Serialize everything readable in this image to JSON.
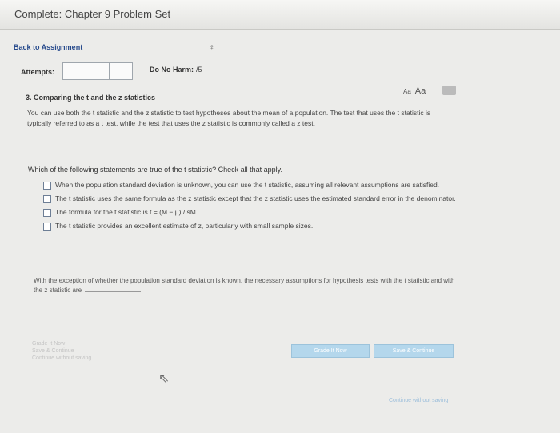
{
  "window": {
    "title": "Complete: Chapter 9 Problem Set",
    "title_extra": "."
  },
  "nav": {
    "back_link": "Back to Assignment",
    "top_icon": "♀"
  },
  "attempts": {
    "label": "Attempts:",
    "boxes": [
      "",
      "",
      ""
    ]
  },
  "do_no_harm": {
    "label": "Do No Harm:",
    "value": "/5"
  },
  "question": {
    "title": "3. Comparing the t and the z statistics",
    "font_controls": {
      "small": "Aa",
      "large": "Aa"
    },
    "intro": "You can use both the t statistic and the z statistic to test hypotheses about the mean of a population. The test that uses the t statistic is typically referred to as a t test, while the test that uses the z statistic is commonly called a z test.",
    "prompt": "Which of the following statements are true of the t statistic? Check all that apply.",
    "options": [
      {
        "text": "When the population standard deviation is unknown, you can use the t statistic, assuming all relevant assumptions are satisfied.",
        "checked": false
      },
      {
        "text": "The t statistic uses the same formula as the z statistic except that the z statistic uses the estimated standard error in the denominator.",
        "checked": false
      },
      {
        "text": "The formula for the t statistic is t = (M − μ) / sM.",
        "checked": false
      },
      {
        "text": "The t statistic provides an excellent estimate of z, particularly with small sample sizes.",
        "checked": false
      }
    ],
    "followup": "With the exception of whether the population standard deviation is known, the necessary assumptions for hypothesis tests with the t statistic and with the z statistic are"
  },
  "footer": {
    "faded_lines": [
      "Grade It Now",
      "Save & Continue",
      "Continue without saving"
    ],
    "grade_button": "Grade It Now",
    "save_button": "Save & Continue",
    "continue_link": "Continue without saving"
  }
}
